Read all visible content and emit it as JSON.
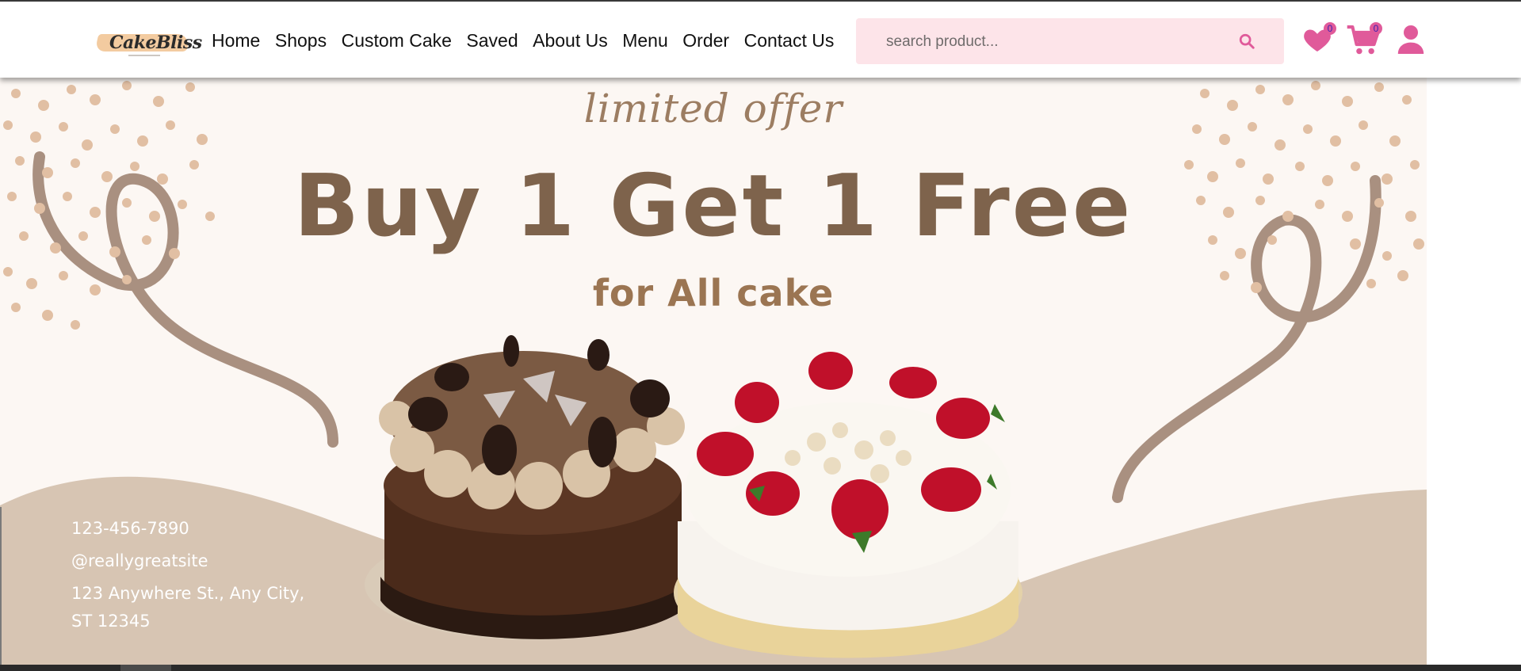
{
  "brand": {
    "logo_text": "CakeBliss"
  },
  "nav": {
    "items": [
      {
        "label": "Home"
      },
      {
        "label": "Shops"
      },
      {
        "label": "Custom Cake"
      },
      {
        "label": "Saved"
      },
      {
        "label": "About Us"
      },
      {
        "label": "Menu"
      },
      {
        "label": "Order"
      },
      {
        "label": "Contact Us"
      }
    ]
  },
  "search": {
    "placeholder": "search product...",
    "icon": "search-icon"
  },
  "header_icons": {
    "wishlist": {
      "icon": "heart-icon",
      "count": "0"
    },
    "cart": {
      "icon": "cart-icon",
      "count": "0"
    },
    "account": {
      "icon": "user-icon"
    }
  },
  "banner": {
    "tagline": "limited offer",
    "headline": "Buy 1 Get 1 Free",
    "subheadline": "for All cake",
    "phone": "123-456-7890",
    "handle": "@reallygreatsite",
    "address_line1": "123 Anywhere St., Any City,",
    "address_line2": "ST 12345"
  },
  "colors": {
    "accent_pink": "#e05a9a",
    "search_bg": "#fde4e9",
    "banner_bg": "#fcf7f3",
    "wave": "#d7c5b3",
    "headline_brown": "#7e634c"
  }
}
